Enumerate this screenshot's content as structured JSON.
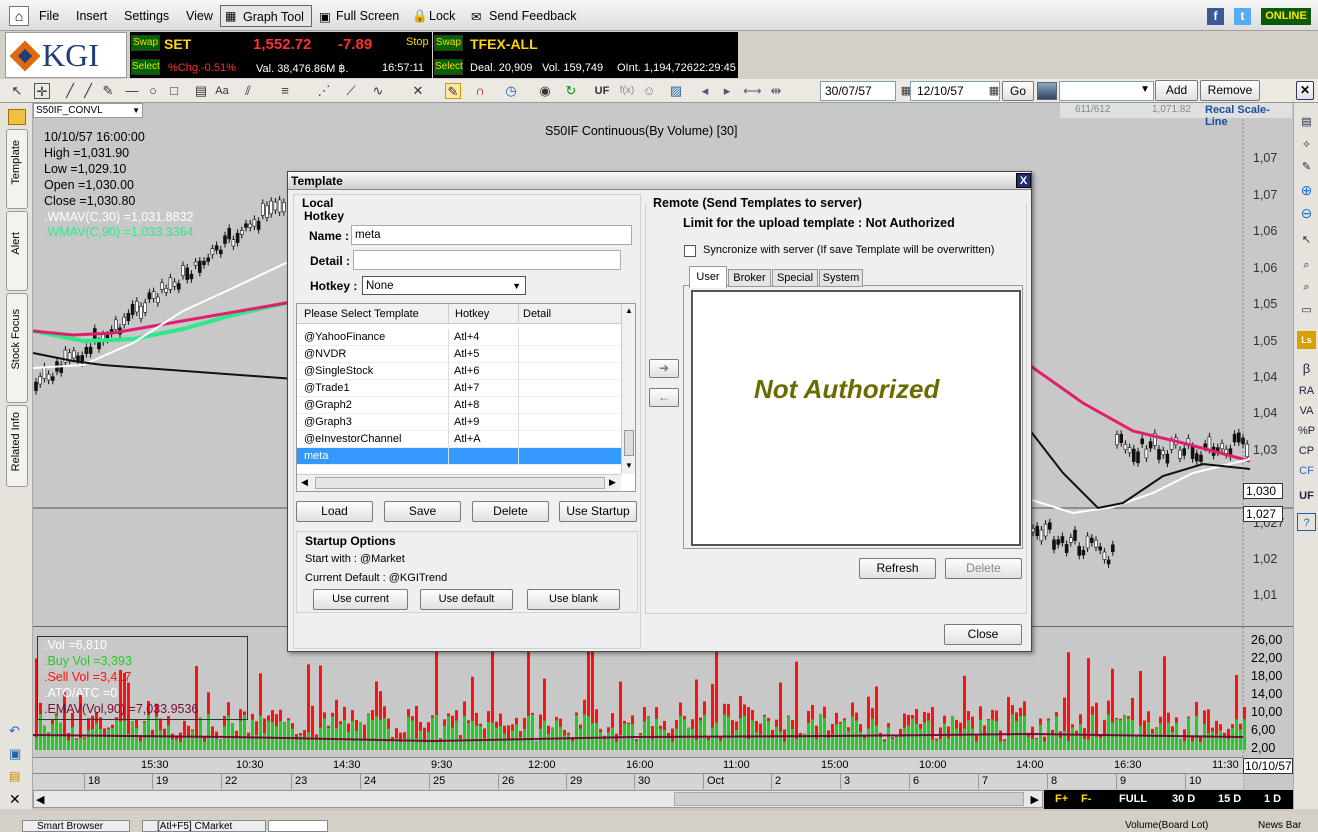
{
  "menu": {
    "items": [
      "File",
      "Insert",
      "Settings",
      "View",
      "Graph Tool",
      "Full Screen",
      "Lock",
      "Send Feedback"
    ],
    "online": "ONLINE"
  },
  "logo": {
    "text": "KGI"
  },
  "ticker1": {
    "swap": "Swap",
    "select": "Select",
    "symbol": "SET",
    "price": "1,552.72",
    "change": "-7.89",
    "stop": "Stop",
    "pct": "%Chg.-0.51%",
    "val": "Val. 38,476.86M ฿.",
    "time": "16:57:11"
  },
  "ticker2": {
    "swap": "Swap",
    "select": "Select",
    "symbol": "TFEX-ALL",
    "deal": "Deal. 20,909",
    "vol": "Vol. 159,749",
    "oint": "OInt. 1,194,726",
    "time": "22:29:45"
  },
  "toolbar": {
    "uf": "UF",
    "date_from": "30/07/57",
    "date_to": "12/10/57",
    "go": "Go",
    "add": "Add",
    "remove": "Remove",
    "page": "611/612",
    "value": "1,071.82",
    "recal": "Recal Scale-Line"
  },
  "chart": {
    "symbol": "S50IF_CONVL",
    "title": "S50IF Continuous(By Volume) [30]",
    "info": [
      "10/10/57 16:00:00",
      "High  =1,031.90",
      "Low  =1,029.10",
      "Open  =1,030.00",
      "Close  =1,030.80"
    ],
    "wmav30": ".WMAV(C,30)    =1,031.8832",
    "wmav90": ".WMAV(C,90)    =1,033.3364",
    "yaxis": [
      "1,07",
      "1,07",
      "1,06",
      "1,06",
      "1,05",
      "1,05",
      "1,04",
      "1,04",
      "1,03",
      "1,027",
      "1,02",
      "1,01"
    ],
    "last1": "1,030",
    "last2": "1,027",
    "vol": {
      "vol": ".Vol    =6,810",
      "buy": ".Buy Vol    =3,393",
      "sell": ".Sell Vol    =3,417",
      "ato": ".ATO/ATC    =0",
      "emav": ".EMAV(Vol,90)    =7,033.9536"
    },
    "volaxis": [
      "26,00",
      "22,00",
      "18,00",
      "14,00",
      "10,00",
      "6,00",
      "2,00"
    ],
    "times": [
      "15:30",
      "10:30",
      "14:30",
      "9:30",
      "12:00",
      "16:00",
      "11:00",
      "15:00",
      "10:00",
      "14:00",
      "16:30",
      "11:30"
    ],
    "dates": [
      "18",
      "19",
      "22",
      "23",
      "24",
      "25",
      "26",
      "29",
      "30",
      "Oct",
      "2",
      "3",
      "6",
      "7",
      "8",
      "9",
      "10"
    ],
    "lastdate": "10/10/57",
    "bottom": [
      "F+",
      "F-",
      "FULL",
      "30 D",
      "15 D",
      "1 D"
    ],
    "series_colors": {
      "wmav30": "#ffffff",
      "wmav90": "#2ee88a",
      "ema": "#e0206e",
      "volbuy": "#22cc22",
      "volsell": "#ff1010"
    }
  },
  "sidetabs": [
    "Template",
    "Alert",
    "Stock Focus",
    "Related Info"
  ],
  "righticons": [
    "β",
    "RA",
    "VA",
    "%P",
    "CP",
    "CF",
    "UF"
  ],
  "dialog": {
    "title": "Template",
    "close_x": "X",
    "local": "Local",
    "hotkey_section": "Hotkey",
    "name_label": "Name :",
    "name_value": "meta",
    "detail_label": "Detail :",
    "hotkey_label": "Hotkey :",
    "hotkey_value": "None",
    "columns": [
      "Please Select Template",
      "Hotkey",
      "Detail"
    ],
    "rows": [
      [
        "@YahooFinance",
        "Atl+4"
      ],
      [
        "@NVDR",
        "Atl+5"
      ],
      [
        "@SingleStock",
        "Atl+6"
      ],
      [
        "@Trade1",
        "Atl+7"
      ],
      [
        "@Graph2",
        "Atl+8"
      ],
      [
        "@Graph3",
        "Atl+9"
      ],
      [
        "@eInvestorChannel",
        "Atl+A"
      ],
      [
        "meta",
        ""
      ]
    ],
    "load": "Load",
    "save": "Save",
    "delete": "Delete",
    "use_startup": "Use Startup",
    "startup": "Startup Options",
    "start_with": "Start with :   @Market",
    "current_default": "Current Default :   @KGITrend",
    "use_current": "Use current",
    "use_default": "Use default",
    "use_blank": "Use blank",
    "remote": "Remote (Send Templates to server)",
    "limit": "Limit for the upload template :   Not Authorized",
    "sync": "Syncronize with server  (If save Template will be overwritten)",
    "tabs": [
      "User",
      "Broker",
      "Special",
      "System"
    ],
    "not_auth": "Not Authorized",
    "refresh": "Refresh",
    "rdelete": "Delete",
    "close": "Close"
  },
  "taskbar": [
    "Smart Browser",
    "[Atl+F5] CMarket",
    "Volume(Board Lot)",
    "News Bar"
  ]
}
